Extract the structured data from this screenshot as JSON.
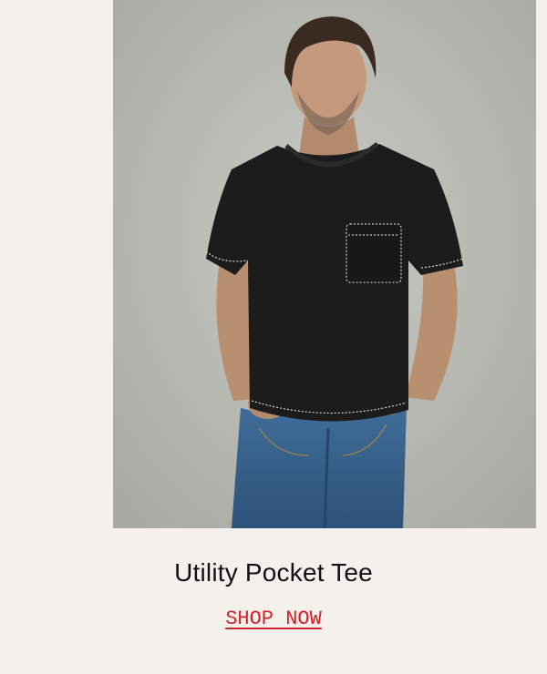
{
  "product": {
    "title": "Utility Pocket Tee",
    "cta_label": "SHOP NOW"
  },
  "colors": {
    "page_background": "#f4f1ec",
    "cta": "#d6202b",
    "title": "#111111"
  }
}
